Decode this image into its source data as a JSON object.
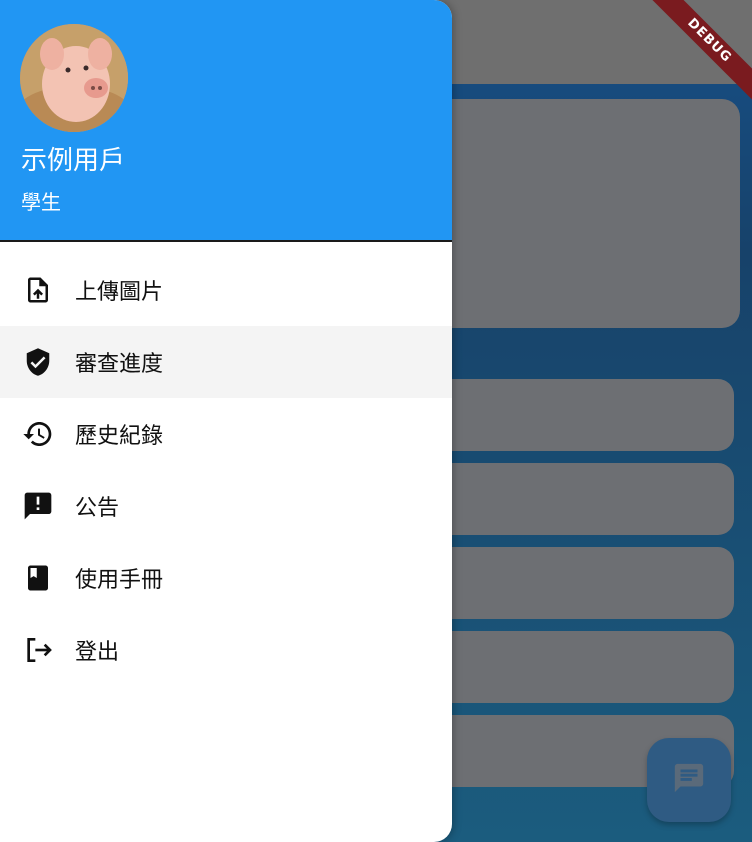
{
  "debug_banner": "DEBUG",
  "drawer": {
    "user_name": "示例用戶",
    "user_role": "學生",
    "header_color": "#2196f3",
    "items": [
      {
        "label": "上傳圖片",
        "icon": "upload-file-icon",
        "selected": false
      },
      {
        "label": "審查進度",
        "icon": "verified-shield-icon",
        "selected": true
      },
      {
        "label": "歷史紀錄",
        "icon": "history-icon",
        "selected": false
      },
      {
        "label": "公告",
        "icon": "announcement-icon",
        "selected": false
      },
      {
        "label": "使用手冊",
        "icon": "book-icon",
        "selected": false
      },
      {
        "label": "登出",
        "icon": "logout-icon",
        "selected": false
      }
    ]
  },
  "fab": {
    "icon": "chat-icon"
  }
}
